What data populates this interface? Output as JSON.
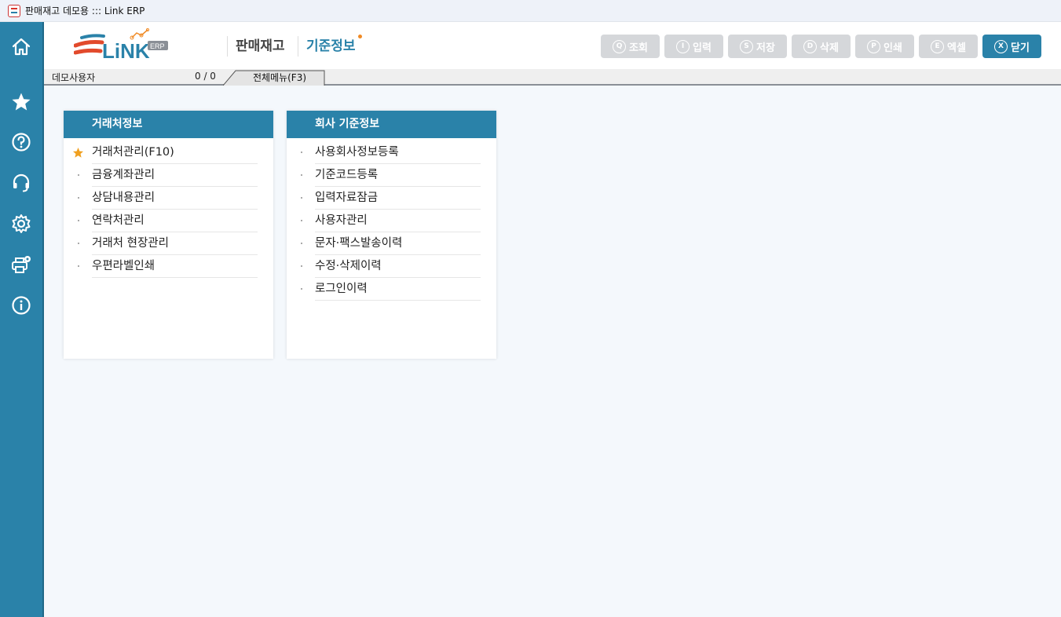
{
  "window": {
    "title": "판매재고 데모용 ::: Link ERP"
  },
  "sidebar": {
    "items": [
      {
        "icon": "home-icon"
      },
      {
        "icon": "star-icon"
      },
      {
        "icon": "help-icon"
      },
      {
        "icon": "headset-icon"
      },
      {
        "icon": "gear-icon"
      },
      {
        "icon": "printer-settings-icon"
      },
      {
        "icon": "info-icon"
      }
    ]
  },
  "header": {
    "logo_text": "LiNK",
    "logo_badge": "ERP",
    "module": "판매재고",
    "page": "기준정보"
  },
  "toolbar": {
    "buttons": [
      {
        "key": "Q",
        "label": "조회"
      },
      {
        "key": "I",
        "label": "입력"
      },
      {
        "key": "S",
        "label": "저장"
      },
      {
        "key": "D",
        "label": "삭제"
      },
      {
        "key": "P",
        "label": "인쇄"
      },
      {
        "key": "E",
        "label": "엑셀"
      },
      {
        "key": "X",
        "label": "닫기"
      }
    ]
  },
  "status": {
    "user": "데모사용자",
    "count": "0 / 0",
    "menu_tab": "전체메뉴(F3)"
  },
  "panels": [
    {
      "title": "거래처정보",
      "items": [
        "거래처관리(F10)",
        "금융계좌관리",
        "상담내용관리",
        "연락처관리",
        "거래처 현장관리",
        "우편라벨인쇄"
      ]
    },
    {
      "title": "회사 기준정보",
      "items": [
        "사용회사정보등록",
        "기준코드등록",
        "입력자료잠금",
        "사용자관리",
        "문자·팩스발송이력",
        "수정·삭제이력",
        "로그인이력"
      ]
    }
  ],
  "colors": {
    "accent": "#2a82a9",
    "favorite": "#f0a020",
    "disabled_button": "#d5d7da"
  }
}
